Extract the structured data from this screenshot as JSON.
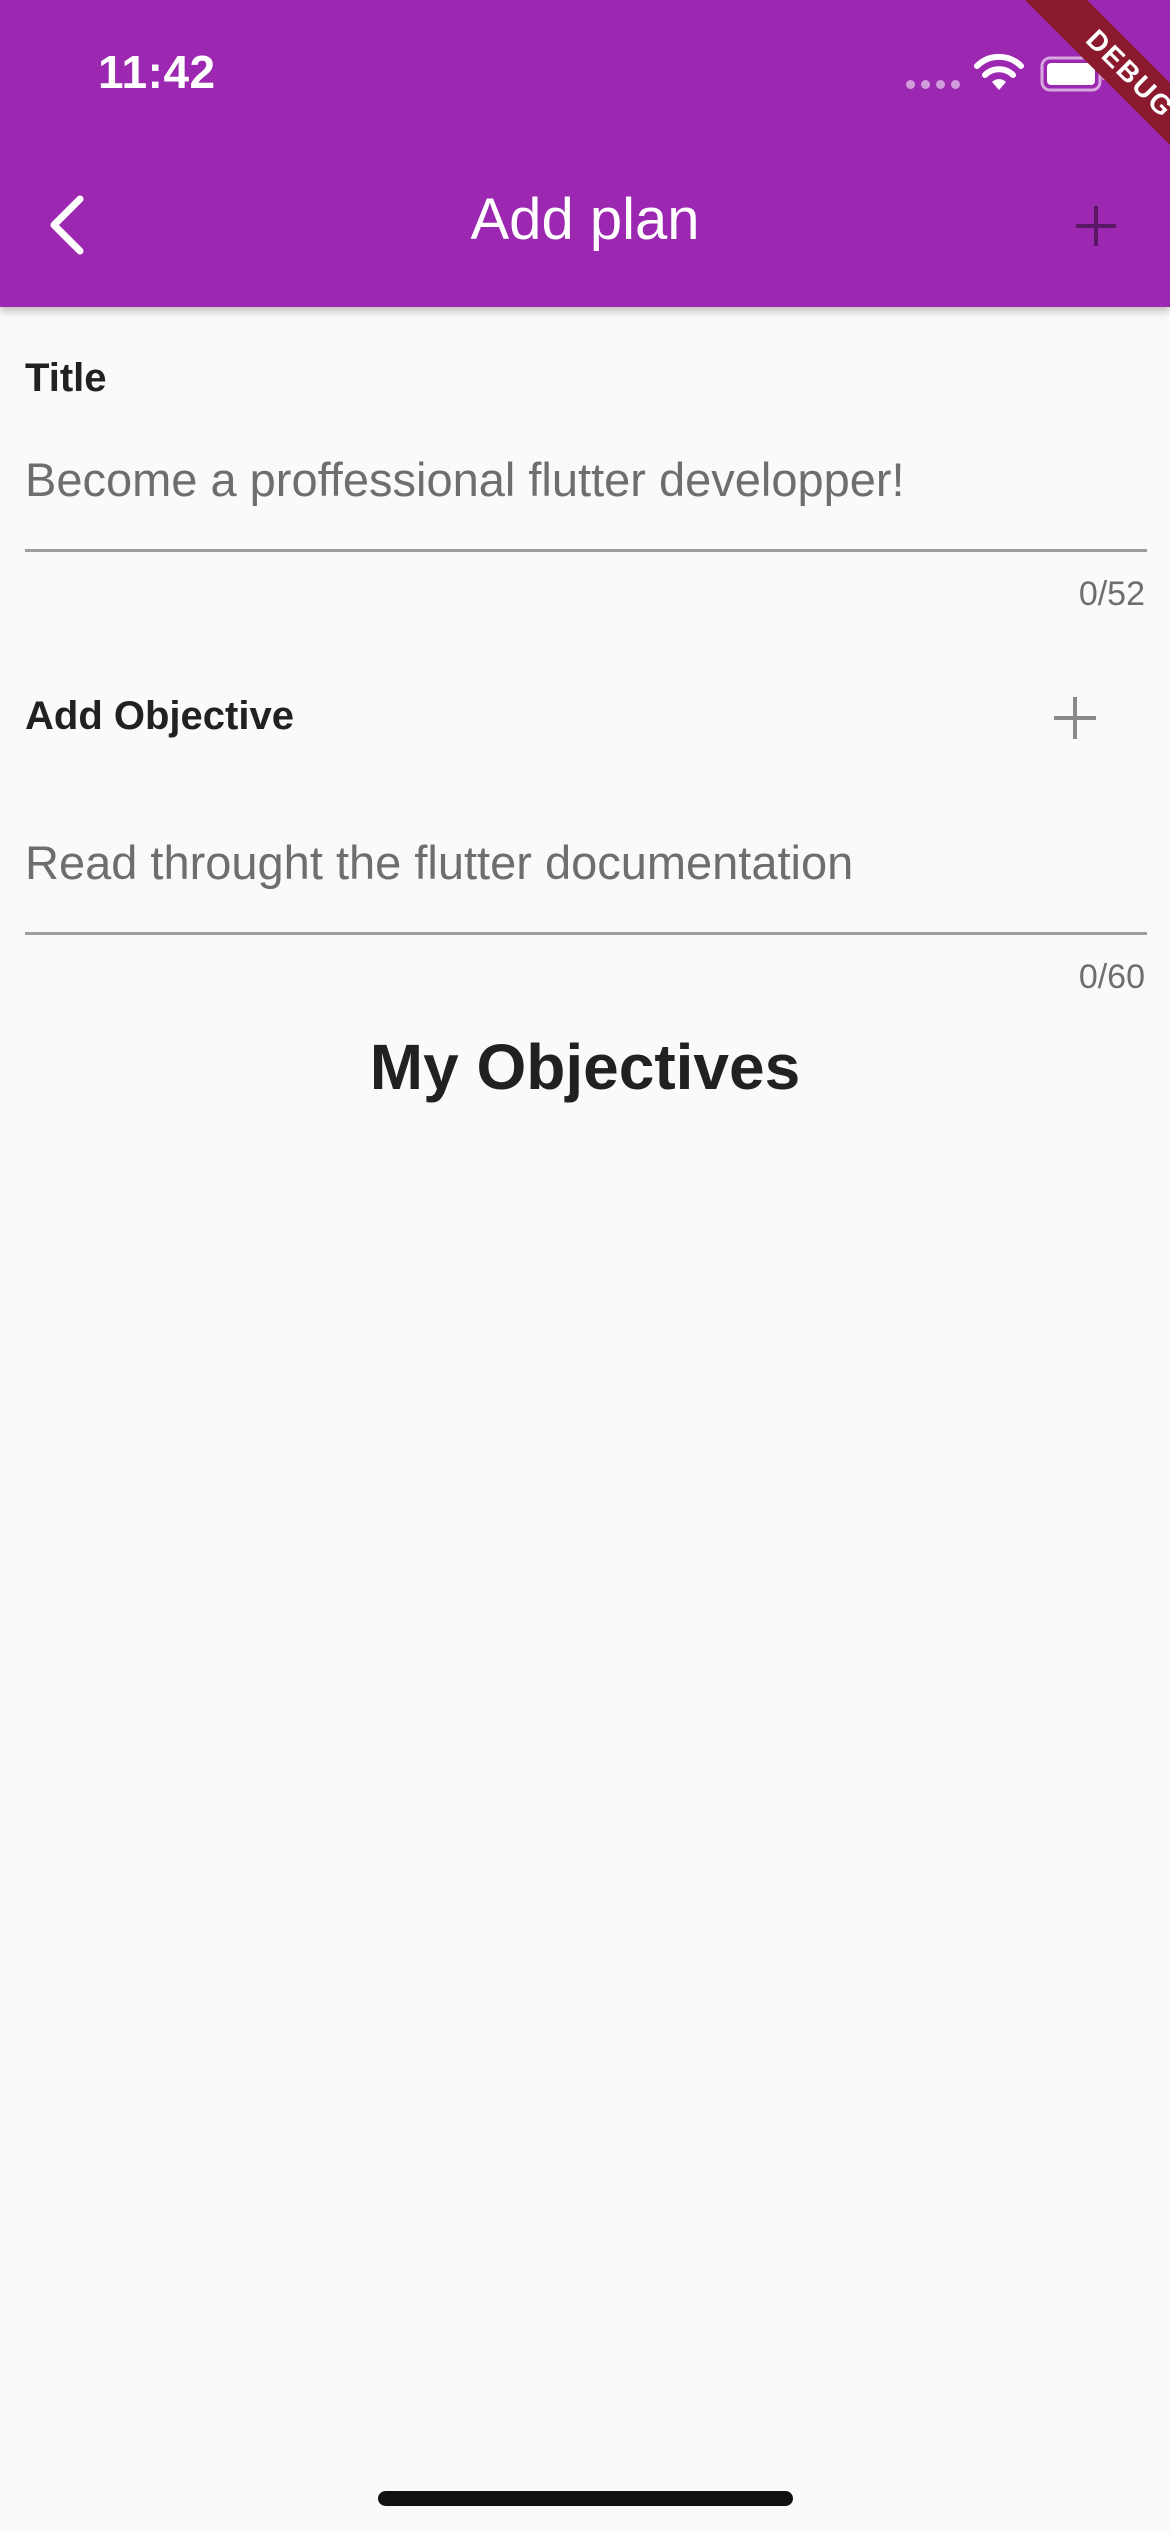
{
  "status_bar": {
    "time": "11:42"
  },
  "debug_banner": "DEBUG",
  "app_bar": {
    "title": "Add plan",
    "back_icon": "chevron-left-icon",
    "add_icon": "plus-icon"
  },
  "title_field": {
    "label": "Title",
    "value": "",
    "placeholder": "Become a proffessional flutter developper!",
    "counter": "0/52"
  },
  "objective_field": {
    "label": "Add Objective",
    "add_icon": "plus-icon",
    "value": "",
    "placeholder": "Read throught the flutter documentation",
    "counter": "0/60"
  },
  "objectives_section": {
    "title": "My Objectives",
    "items": []
  },
  "colors": {
    "primary": "#9c27b0",
    "background": "#fafafa",
    "debug_ribbon": "#8b1a2e",
    "text": "#212121",
    "hint": "#6e6e6e"
  }
}
